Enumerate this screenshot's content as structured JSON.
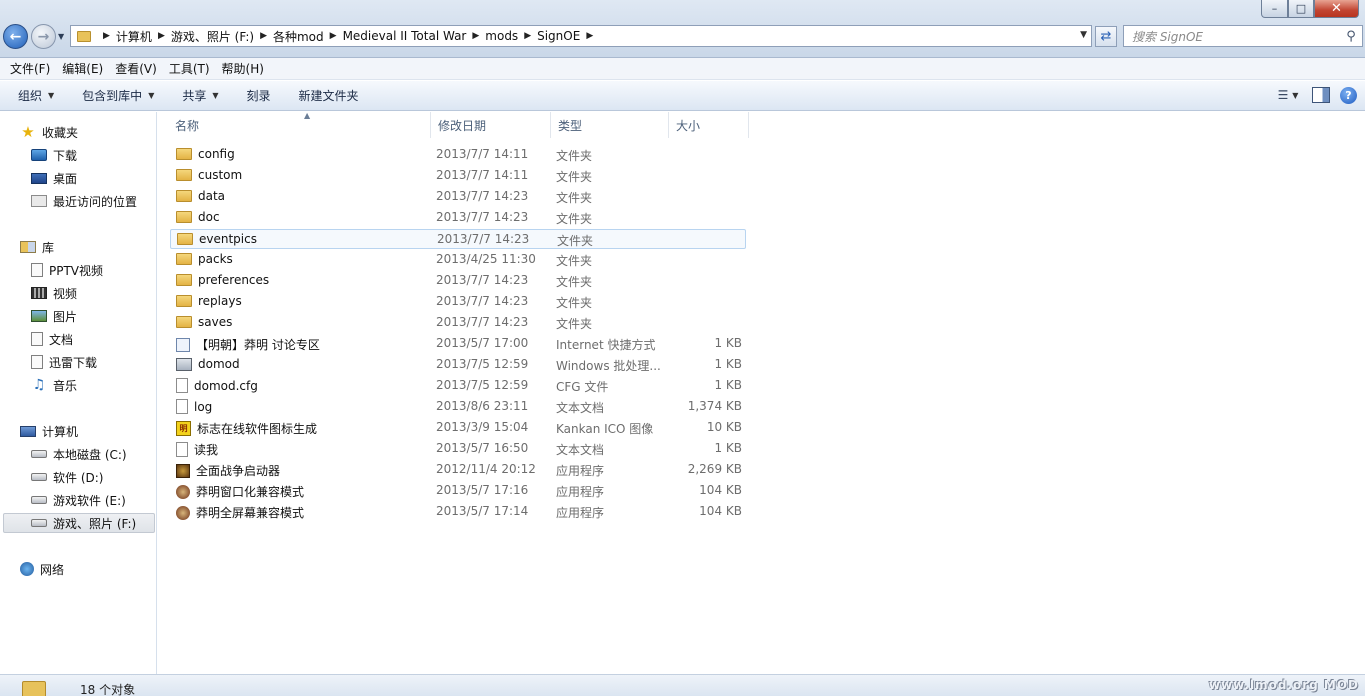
{
  "window": {
    "min_label": "–",
    "max_label": "□",
    "close_label": "✕"
  },
  "address": {
    "crumbs": [
      "计算机",
      "游戏、照片 (F:)",
      "各种mod",
      "Medieval II Total War",
      "mods",
      "SignOE"
    ],
    "search_placeholder": "搜索 SignOE"
  },
  "menubar": [
    "文件(F)",
    "编辑(E)",
    "查看(V)",
    "工具(T)",
    "帮助(H)"
  ],
  "commands": {
    "organize": "组织",
    "include": "包含到库中",
    "share": "共享",
    "burn": "刻录",
    "new_folder": "新建文件夹"
  },
  "nav": {
    "favorites": "收藏夹",
    "fav_items": [
      "下载",
      "桌面",
      "最近访问的位置"
    ],
    "libraries": "库",
    "lib_items": [
      "PPTV视频",
      "视频",
      "图片",
      "文档",
      "迅雷下载",
      "音乐"
    ],
    "computer": "计算机",
    "drives": [
      "本地磁盘 (C:)",
      "软件 (D:)",
      "游戏软件 (E:)",
      "游戏、照片 (F:)"
    ],
    "network": "网络"
  },
  "columns": {
    "name": "名称",
    "date": "修改日期",
    "type": "类型",
    "size": "大小"
  },
  "files": [
    {
      "name": "config",
      "date": "2013/7/7 14:11",
      "type": "文件夹",
      "size": "",
      "icon": "folder-icon"
    },
    {
      "name": "custom",
      "date": "2013/7/7 14:11",
      "type": "文件夹",
      "size": "",
      "icon": "folder-icon"
    },
    {
      "name": "data",
      "date": "2013/7/7 14:23",
      "type": "文件夹",
      "size": "",
      "icon": "folder-icon"
    },
    {
      "name": "doc",
      "date": "2013/7/7 14:23",
      "type": "文件夹",
      "size": "",
      "icon": "folder-icon"
    },
    {
      "name": "eventpics",
      "date": "2013/7/7 14:23",
      "type": "文件夹",
      "size": "",
      "icon": "folder-icon"
    },
    {
      "name": "packs",
      "date": "2013/4/25 11:30",
      "type": "文件夹",
      "size": "",
      "icon": "folder-icon"
    },
    {
      "name": "preferences",
      "date": "2013/7/7 14:23",
      "type": "文件夹",
      "size": "",
      "icon": "folder-icon"
    },
    {
      "name": "replays",
      "date": "2013/7/7 14:23",
      "type": "文件夹",
      "size": "",
      "icon": "folder-icon"
    },
    {
      "name": "saves",
      "date": "2013/7/7 14:23",
      "type": "文件夹",
      "size": "",
      "icon": "folder-icon"
    },
    {
      "name": "【明朝】莽明 讨论专区",
      "date": "2013/5/7 17:00",
      "type": "Internet 快捷方式",
      "size": "1 KB",
      "icon": "internet-shortcut-icon"
    },
    {
      "name": "domod",
      "date": "2013/7/5 12:59",
      "type": "Windows 批处理...",
      "size": "1 KB",
      "icon": "batch-file-icon"
    },
    {
      "name": "domod.cfg",
      "date": "2013/7/5 12:59",
      "type": "CFG 文件",
      "size": "1 KB",
      "icon": "file-icon"
    },
    {
      "name": "log",
      "date": "2013/8/6 23:11",
      "type": "文本文档",
      "size": "1,374 KB",
      "icon": "text-file-icon"
    },
    {
      "name": "标志在线软件图标生成",
      "date": "2013/3/9 15:04",
      "type": "Kankan ICO 图像",
      "size": "10 KB",
      "icon": "ico-image-icon"
    },
    {
      "name": "读我",
      "date": "2013/5/7 16:50",
      "type": "文本文档",
      "size": "1 KB",
      "icon": "text-file-icon"
    },
    {
      "name": "全面战争启动器",
      "date": "2012/11/4 20:12",
      "type": "应用程序",
      "size": "2,269 KB",
      "icon": "launcher-app-icon"
    },
    {
      "name": "莽明窗口化兼容模式",
      "date": "2013/5/7 17:16",
      "type": "应用程序",
      "size": "104 KB",
      "icon": "game-app-icon"
    },
    {
      "name": "莽明全屏幕兼容模式",
      "date": "2013/5/7 17:14",
      "type": "应用程序",
      "size": "104 KB",
      "icon": "game-app-icon"
    }
  ],
  "status": {
    "count": "18 个对象",
    "watermark": "www.lmod.org  MOD"
  }
}
